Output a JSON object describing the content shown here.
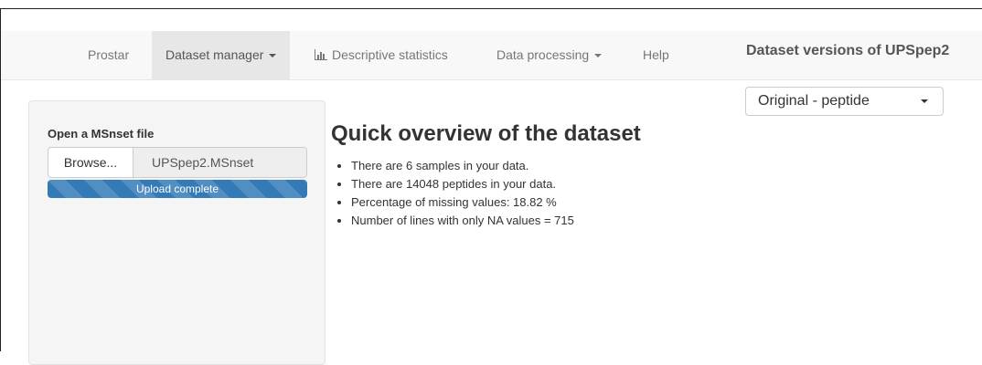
{
  "navbar": {
    "brand": "Prostar",
    "items": [
      {
        "label": "Dataset manager",
        "has_dropdown": true,
        "active": true
      },
      {
        "label": "Descriptive statistics",
        "icon": "bar-chart-icon"
      },
      {
        "label": "Data processing",
        "has_dropdown": true
      },
      {
        "label": "Help"
      }
    ]
  },
  "versions": {
    "title": "Dataset versions of UPSpep2",
    "selected": "Original - peptide"
  },
  "sidebar": {
    "label": "Open a MSnset file",
    "browse_label": "Browse...",
    "file_name": "UPSpep2.MSnset",
    "progress_text": "Upload complete",
    "progress_fraction": 1.0
  },
  "main": {
    "title": "Quick overview of the dataset",
    "stats": [
      "There are 6 samples in your data.",
      "There are 14048 peptides in your data.",
      "Percentage of missing values: 18.82 %",
      "Number of lines with only NA values = 715"
    ]
  },
  "colors": {
    "navbar_bg": "#f8f8f8",
    "active_tab_bg": "#e7e7e7",
    "progress_bar": "#337ab7"
  }
}
